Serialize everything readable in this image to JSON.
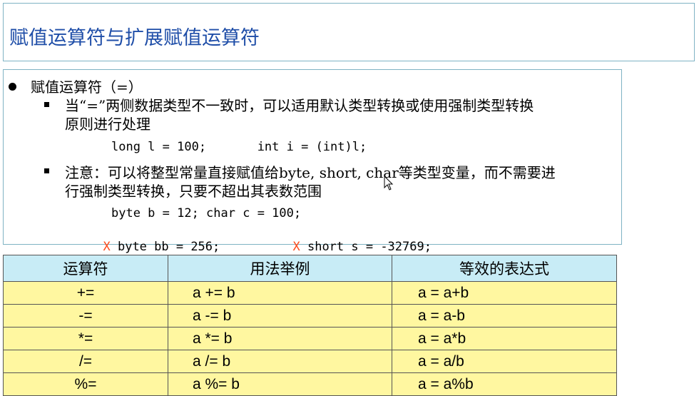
{
  "title": "赋值运算符与扩展赋值运算符",
  "section": {
    "heading": "赋值运算符（=）",
    "bullet1": {
      "line1": "当“=”两侧数据类型不一致时，可以适用默认类型转换或使用强制类型转换",
      "line2": "原则进行处理",
      "code": "long l = 100;       int i = (int)l;"
    },
    "bullet2": {
      "line1": "注意：可以将整型常量直接赋值给byte, short, char等类型变量，而不需要进",
      "line2": "行强制类型转换，只要不超出其表数范围",
      "code1": "byte b = 12; char c = 100;",
      "x_mark": "X",
      "code2a": " byte bb = 256;",
      "code2b": " short s = -32769;"
    }
  },
  "table": {
    "headers": [
      "运算符",
      "用法举例",
      "等效的表达式"
    ],
    "rows": [
      [
        "+=",
        "a += b",
        "a = a+b"
      ],
      [
        "-=",
        "a -= b",
        "a = a-b"
      ],
      [
        "*=",
        "a *= b",
        "a = a*b"
      ],
      [
        "/=",
        "a /= b",
        "a = a/b"
      ],
      [
        "%=",
        "a %= b",
        "a = a%b"
      ]
    ]
  },
  "colors": {
    "title": "#1f4ea8",
    "x_mark": "#ff4a1a",
    "table_header": "#c8ecf6",
    "table_cell": "#fff7a0",
    "box_border": "#7fb3c4"
  },
  "icons": [
    "bullet-dot",
    "square-bullet",
    "mouse-cursor-icon"
  ]
}
